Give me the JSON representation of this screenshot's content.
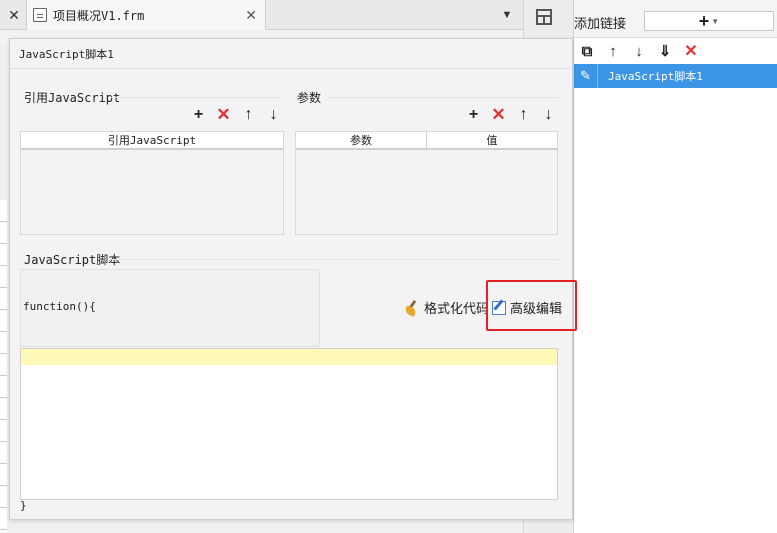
{
  "editor_tab": {
    "file_name": "项目概况V1.frm",
    "close_glyph": "✕"
  },
  "right_panel": {
    "title": "添加链接",
    "add_glyph": "+",
    "tools": [
      {
        "name": "copy-icon",
        "glyph": "⧉"
      },
      {
        "name": "move-up-icon",
        "glyph": "↑"
      },
      {
        "name": "move-down-icon",
        "glyph": "↓"
      },
      {
        "name": "move-bottom-icon",
        "glyph": "⇓"
      },
      {
        "name": "delete-icon",
        "glyph": "✕"
      }
    ],
    "selected_item": "JavaScript脚本1"
  },
  "dialog": {
    "title": "JavaScript脚本1",
    "ref_section": {
      "label": "引用JavaScript",
      "columns": [
        "引用JavaScript"
      ],
      "rows": []
    },
    "params_section": {
      "label": "参数",
      "columns": [
        "参数",
        "值"
      ],
      "rows": []
    },
    "script_section": {
      "label": "JavaScript脚本",
      "function_open": "function(){",
      "function_close": "}",
      "format_label": "格式化代码",
      "advanced_label": "高级编辑"
    }
  },
  "colors": {
    "selection_blue": "#3d95e8",
    "highlight_red": "#e02222",
    "delete_red": "#e03030",
    "current_line_yellow": "#fff9b8"
  }
}
